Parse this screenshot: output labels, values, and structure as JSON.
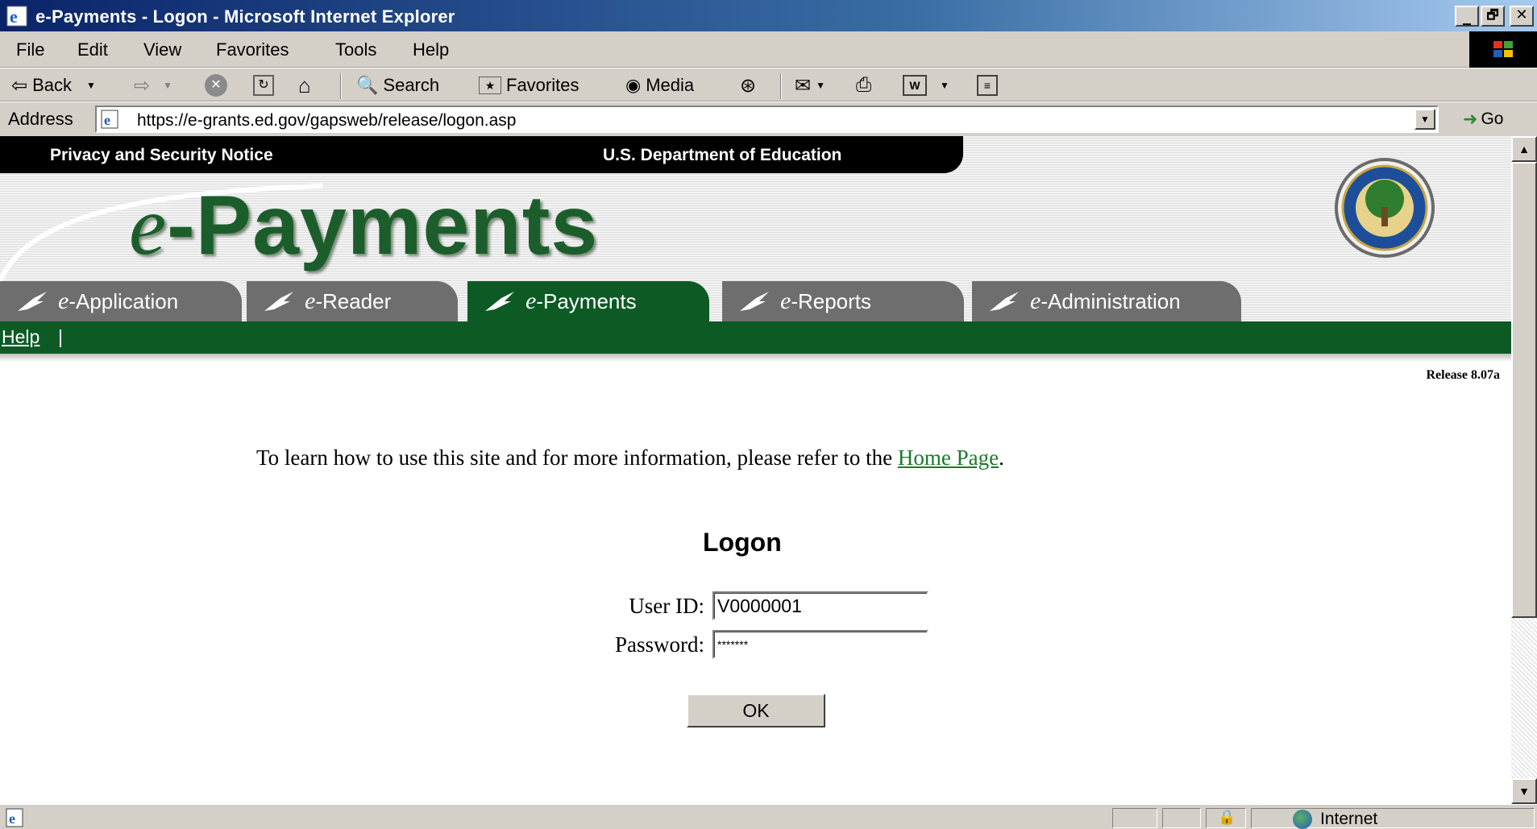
{
  "window": {
    "title": "e-Payments - Logon - Microsoft Internet Explorer",
    "controls": [
      "_",
      "🗗",
      "✕"
    ]
  },
  "menu": [
    "File",
    "Edit",
    "View",
    "Favorites",
    "Tools",
    "Help"
  ],
  "toolbar": {
    "back": "Back",
    "search": "Search",
    "favorites": "Favorites",
    "media": "Media"
  },
  "address": {
    "label": "Address",
    "url": "https://e-grants.ed.gov/gapsweb/release/logon.asp",
    "go": "Go"
  },
  "banner": {
    "privacy": "Privacy and Security Notice",
    "department": "U.S. Department of Education",
    "logo_e": "e",
    "logo_rest": "-Payments"
  },
  "tabs": [
    {
      "e": "e",
      "label": "-Application",
      "active": false
    },
    {
      "e": "e",
      "label": "-Reader",
      "active": false
    },
    {
      "e": "e",
      "label": "-Payments",
      "active": true
    },
    {
      "e": "e",
      "label": "-Reports",
      "active": false
    },
    {
      "e": "e",
      "label": "-Administration",
      "active": false
    }
  ],
  "nav": {
    "help": "Help",
    "separator": "|"
  },
  "release": "Release 8.07a",
  "info": {
    "text": "To learn how to use this site and for more information, please refer to the ",
    "link": "Home Page",
    "end": "."
  },
  "logon": {
    "title": "Logon",
    "user_label": "User ID:",
    "user_value": "V0000001",
    "password_label": "Password:",
    "password_value": "*******",
    "ok": "OK"
  },
  "status": {
    "zone": "Internet"
  },
  "colors": {
    "green": "#0d5a25",
    "tab_gray": "#6e6e6e",
    "title_blue": "#0a246a"
  }
}
